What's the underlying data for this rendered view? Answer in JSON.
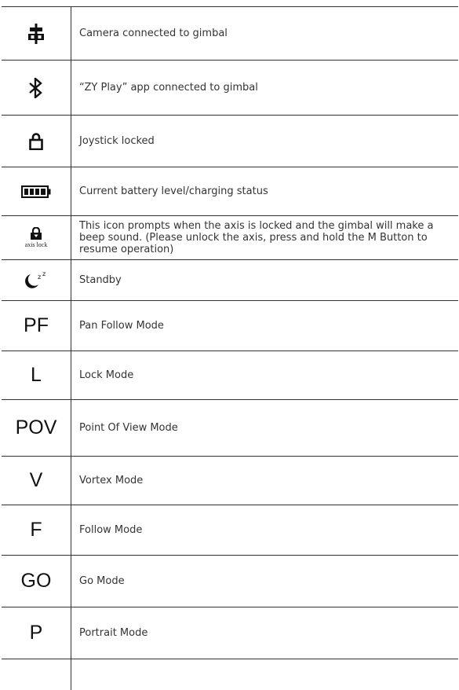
{
  "rows": [
    {
      "icon": "gimbal-connected-icon",
      "text": "Camera connected to gimbal"
    },
    {
      "icon": "bluetooth-icon",
      "text": "“ZY Play” app connected to gimbal"
    },
    {
      "icon": "lock-icon",
      "text": "Joystick locked"
    },
    {
      "icon": "battery-icon",
      "text": "Current battery level/charging status"
    },
    {
      "icon": "axis-lock-icon",
      "icon_label": "axis lock",
      "text": "This icon prompts when the axis is locked and the gimbal will make a beep sound. (Please unlock the axis, press and hold the M Button to resume operation)"
    },
    {
      "icon": "standby-moon-icon",
      "icon_label": "z z",
      "text": "Standby"
    },
    {
      "label": "PF",
      "text": "Pan Follow Mode"
    },
    {
      "label": "L",
      "text": "Lock Mode"
    },
    {
      "label": "POV",
      "text": "Point Of View Mode"
    },
    {
      "label": "V",
      "text": "Vortex Mode"
    },
    {
      "label": "F",
      "text": "Follow Mode"
    },
    {
      "label": "GO",
      "text": "Go Mode"
    },
    {
      "label": "P",
      "text": "Portrait Mode"
    }
  ]
}
